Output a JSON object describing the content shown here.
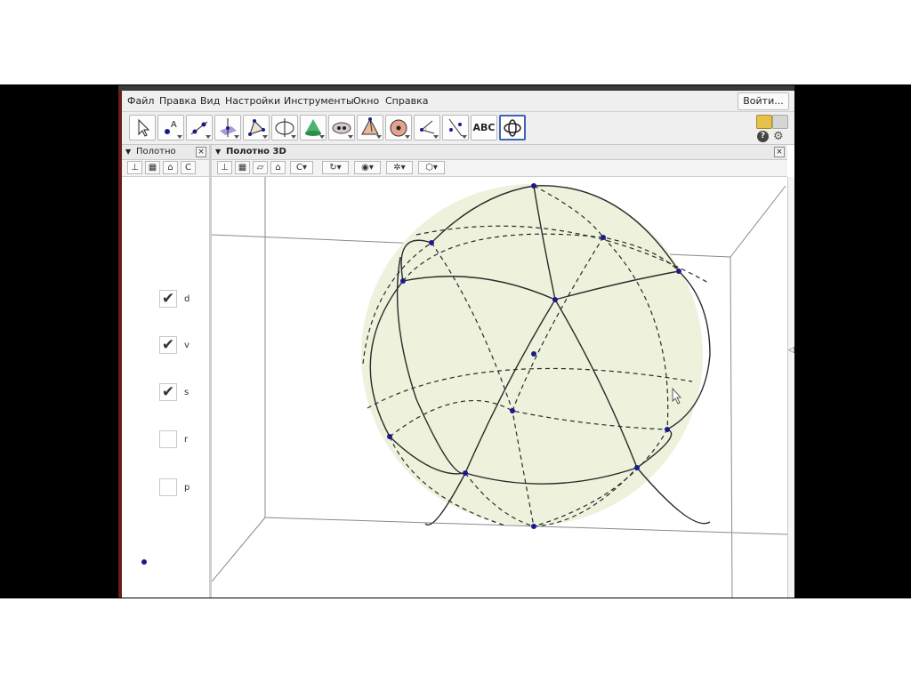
{
  "menu": {
    "items": [
      "Файл",
      "Правка",
      "Вид",
      "Настройки",
      "Инструменты",
      "Окно",
      "Справка"
    ],
    "login_label": "Войти..."
  },
  "toolbar": {
    "tools": [
      "move-tool-icon",
      "point-tool-icon",
      "line-tool-icon",
      "perpendicular-tool-icon",
      "polygon-tool-icon",
      "circle-tool-icon",
      "cone-tool-icon",
      "conic-tool-icon",
      "pyramid-tool-icon",
      "sphere-tool-icon",
      "angle-tool-icon",
      "reflect-tool-icon",
      "text-tool-icon",
      "rotate-view-tool-icon"
    ],
    "text_tool_label": "ABC",
    "help_label": "?"
  },
  "algebra": {
    "title": "Полотно",
    "close_label": "×",
    "checkboxes": [
      {
        "label": "d",
        "checked": true
      },
      {
        "label": "v",
        "checked": true
      },
      {
        "label": "s",
        "checked": true
      },
      {
        "label": "r",
        "checked": false
      },
      {
        "label": "p",
        "checked": false
      }
    ]
  },
  "graphics3d": {
    "title": "Полотно 3D",
    "close_label": "×"
  },
  "colors": {
    "sphere_fill": "#eef2dc",
    "point": "#1a1a8c",
    "selected_border": "#3e64b5"
  }
}
